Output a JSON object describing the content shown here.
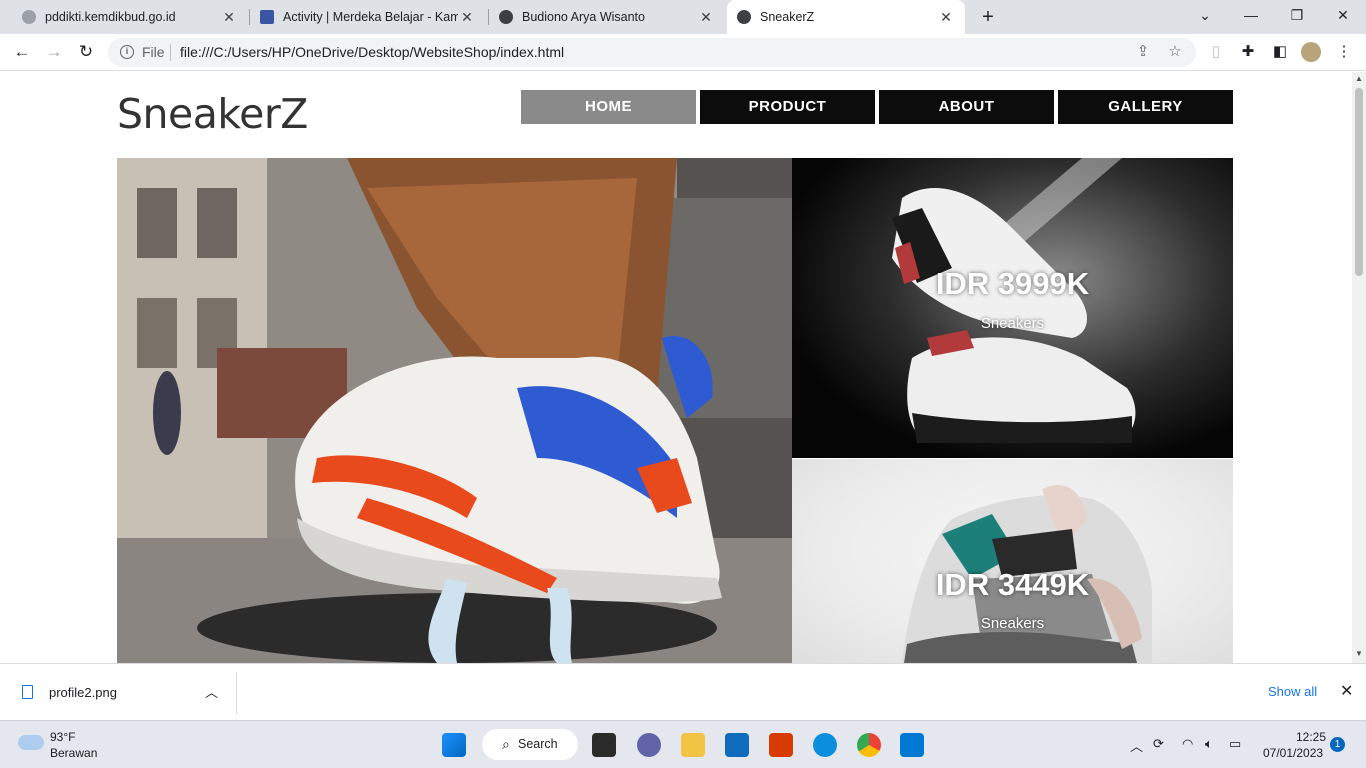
{
  "browser": {
    "tabs": [
      {
        "title": "pddikti.kemdikbud.go.id",
        "active": false
      },
      {
        "title": "Activity | Merdeka Belajar - Kamp",
        "active": false
      },
      {
        "title": "Budiono Arya Wisanto",
        "active": false
      },
      {
        "title": "SneakerZ",
        "active": true
      }
    ],
    "new_tab_label": "+",
    "address": {
      "scheme_label": "File",
      "url": "file:///C:/Users/HP/OneDrive/Desktop/WebsiteShop/index.html"
    }
  },
  "site": {
    "logo": "SneakerZ",
    "nav": [
      {
        "label": "HOME",
        "current": true
      },
      {
        "label": "PRODUCT",
        "current": false
      },
      {
        "label": "ABOUT",
        "current": false
      },
      {
        "label": "GALLERY",
        "current": false
      }
    ],
    "products": [
      {
        "price": "IDR 3999K",
        "type": "Sneakers"
      },
      {
        "price": "IDR 3449K",
        "type": "Sneakers"
      }
    ]
  },
  "downloads": {
    "file_name": "profile2.png",
    "show_all": "Show all"
  },
  "taskbar": {
    "weather_temp": "93°F",
    "weather_condition": "Berawan",
    "search_label": "Search",
    "time": "12:25",
    "date": "07/01/2023",
    "notification_count": "1"
  },
  "colors": {
    "nav_active": "#8a8a8a",
    "nav_default": "#0c0c0c",
    "link": "#1a73e8"
  }
}
